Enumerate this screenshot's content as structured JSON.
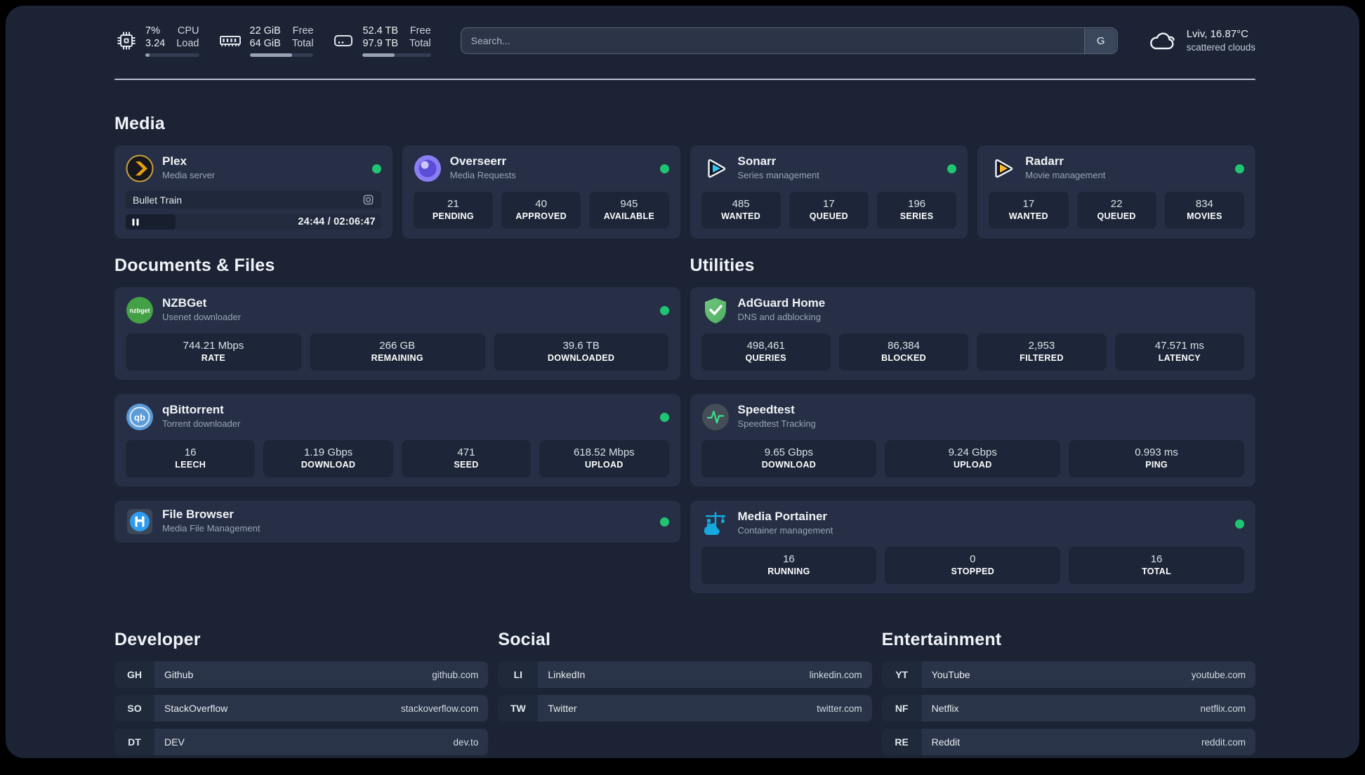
{
  "colors": {
    "status_online": "#1fc572",
    "accent_plex": "#e5a00d"
  },
  "header": {
    "stats": [
      {
        "icon": "cpu-icon",
        "values": [
          "7%",
          "3.24"
        ],
        "labels": [
          "CPU",
          "Load"
        ],
        "progress": 8
      },
      {
        "icon": "ram-icon",
        "values": [
          "22 GiB",
          "64 GiB"
        ],
        "labels": [
          "Free",
          "Total"
        ],
        "progress": 66
      },
      {
        "icon": "disk-icon",
        "values": [
          "52.4 TB",
          "97.9 TB"
        ],
        "labels": [
          "Free",
          "Total"
        ],
        "progress": 47
      }
    ],
    "search": {
      "placeholder": "Search...",
      "button_label": "G"
    },
    "weather": {
      "location_temp": "Lviv, 16.87°C",
      "condition": "scattered clouds"
    }
  },
  "media": {
    "title": "Media",
    "cards": [
      {
        "title": "Plex",
        "subtitle": "Media server",
        "status": "online",
        "player": {
          "track": "Bullet Train",
          "time": "24:44 / 02:06:47",
          "progress": 19.5
        }
      },
      {
        "title": "Overseerr",
        "subtitle": "Media Requests",
        "status": "online",
        "stats": [
          {
            "value": "21",
            "label": "PENDING"
          },
          {
            "value": "40",
            "label": "APPROVED"
          },
          {
            "value": "945",
            "label": "AVAILABLE"
          }
        ]
      },
      {
        "title": "Sonarr",
        "subtitle": "Series management",
        "status": "online",
        "stats": [
          {
            "value": "485",
            "label": "WANTED"
          },
          {
            "value": "17",
            "label": "QUEUED"
          },
          {
            "value": "196",
            "label": "SERIES"
          }
        ]
      },
      {
        "title": "Radarr",
        "subtitle": "Movie management",
        "status": "online",
        "stats": [
          {
            "value": "17",
            "label": "WANTED"
          },
          {
            "value": "22",
            "label": "QUEUED"
          },
          {
            "value": "834",
            "label": "MOVIES"
          }
        ]
      }
    ]
  },
  "documents": {
    "title": "Documents & Files",
    "cards": [
      {
        "title": "NZBGet",
        "subtitle": "Usenet downloader",
        "icon_text": "nzbget",
        "status": "online",
        "stats": [
          {
            "value": "744.21 Mbps",
            "label": "RATE"
          },
          {
            "value": "266 GB",
            "label": "REMAINING"
          },
          {
            "value": "39.6 TB",
            "label": "DOWNLOADED"
          }
        ]
      },
      {
        "title": "qBittorrent",
        "subtitle": "Torrent downloader",
        "icon_text": "qb",
        "status": "online",
        "stats": [
          {
            "value": "16",
            "label": "LEECH"
          },
          {
            "value": "1.19 Gbps",
            "label": "DOWNLOAD"
          },
          {
            "value": "471",
            "label": "SEED"
          },
          {
            "value": "618.52 Mbps",
            "label": "UPLOAD"
          }
        ]
      },
      {
        "title": "File Browser",
        "subtitle": "Media File Management",
        "status": "online"
      }
    ]
  },
  "utilities": {
    "title": "Utilities",
    "cards": [
      {
        "title": "AdGuard Home",
        "subtitle": "DNS and adblocking",
        "stats": [
          {
            "value": "498,461",
            "label": "QUERIES"
          },
          {
            "value": "86,384",
            "label": "BLOCKED"
          },
          {
            "value": "2,953",
            "label": "FILTERED"
          },
          {
            "value": "47.571 ms",
            "label": "LATENCY"
          }
        ]
      },
      {
        "title": "Speedtest",
        "subtitle": "Speedtest Tracking",
        "stats": [
          {
            "value": "9.65 Gbps",
            "label": "DOWNLOAD"
          },
          {
            "value": "9.24 Gbps",
            "label": "UPLOAD"
          },
          {
            "value": "0.993 ms",
            "label": "PING"
          }
        ]
      },
      {
        "title": "Media Portainer",
        "subtitle": "Container management",
        "status": "online",
        "stats": [
          {
            "value": "16",
            "label": "RUNNING"
          },
          {
            "value": "0",
            "label": "STOPPED"
          },
          {
            "value": "16",
            "label": "TOTAL"
          }
        ]
      }
    ]
  },
  "links": [
    {
      "title": "Developer",
      "items": [
        {
          "badge": "GH",
          "name": "Github",
          "url": "github.com"
        },
        {
          "badge": "SO",
          "name": "StackOverflow",
          "url": "stackoverflow.com"
        },
        {
          "badge": "DT",
          "name": "DEV",
          "url": "dev.to"
        }
      ]
    },
    {
      "title": "Social",
      "items": [
        {
          "badge": "LI",
          "name": "LinkedIn",
          "url": "linkedin.com"
        },
        {
          "badge": "TW",
          "name": "Twitter",
          "url": "twitter.com"
        }
      ]
    },
    {
      "title": "Entertainment",
      "items": [
        {
          "badge": "YT",
          "name": "YouTube",
          "url": "youtube.com"
        },
        {
          "badge": "NF",
          "name": "Netflix",
          "url": "netflix.com"
        },
        {
          "badge": "RE",
          "name": "Reddit",
          "url": "reddit.com"
        }
      ]
    }
  ]
}
